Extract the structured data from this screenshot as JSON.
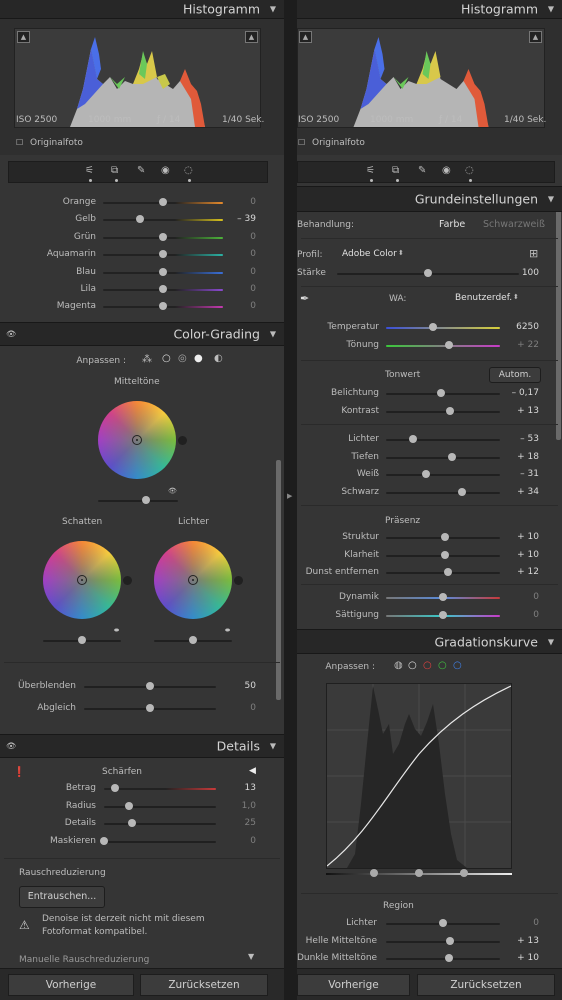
{
  "left": {
    "histogram": {
      "title": "Histogramm",
      "iso": "ISO 2500",
      "focal": "1000 mm",
      "aperture": "ƒ / 14",
      "shutter": "1/40 Sek.",
      "original_label": "Originalfoto"
    },
    "hsl": [
      {
        "name": "Orange",
        "value": "0",
        "dim": true,
        "color": "#e58a2c",
        "pos": 0.5
      },
      {
        "name": "Gelb",
        "value": "– 39",
        "dim": false,
        "color": "#d8c21e",
        "pos": 0.31
      },
      {
        "name": "Grün",
        "value": "0",
        "dim": true,
        "color": "#4db33a",
        "pos": 0.5
      },
      {
        "name": "Aquamarin",
        "value": "0",
        "dim": true,
        "color": "#2bb3a5",
        "pos": 0.5
      },
      {
        "name": "Blau",
        "value": "0",
        "dim": true,
        "color": "#3a6fd8",
        "pos": 0.5
      },
      {
        "name": "Lila",
        "value": "0",
        "dim": true,
        "color": "#8a4ad0",
        "pos": 0.5
      },
      {
        "name": "Magenta",
        "value": "0",
        "dim": true,
        "color": "#c43ab0",
        "pos": 0.5
      }
    ],
    "color_grading": {
      "title": "Color-Grading",
      "adjust_label": "Anpassen :",
      "midtones": "Mitteltöne",
      "shadows": "Schatten",
      "highlights": "Lichter",
      "blending": {
        "label": "Überblenden",
        "value": "50",
        "pos": 0.5
      },
      "balance": {
        "label": "Abgleich",
        "value": "0",
        "pos": 0.5
      }
    },
    "details": {
      "title": "Details",
      "sharpening": "Schärfen",
      "rows": [
        {
          "label": "Betrag",
          "value": "13",
          "dim": false,
          "pos": 0.1
        },
        {
          "label": "Radius",
          "value": "1,0",
          "dim": true,
          "pos": 0.22
        },
        {
          "label": "Details",
          "value": "25",
          "dim": true,
          "pos": 0.25
        },
        {
          "label": "Maskieren",
          "value": "0",
          "dim": true,
          "pos": 0.0
        }
      ],
      "noise_title": "Rauschreduzierung",
      "denoise_button": "Entrauschen...",
      "warning": "Denoise ist derzeit nicht mit diesem Fotoformat kompatibel.",
      "manual": "Manuelle Rauschreduzierung"
    },
    "buttons": {
      "previous": "Vorherige",
      "reset": "Zurücksetzen"
    }
  },
  "right": {
    "histogram": {
      "title": "Histogramm",
      "iso": "ISO 2500",
      "focal": "1000 mm",
      "aperture": "ƒ / 14",
      "shutter": "1/40 Sek.",
      "original_label": "Originalfoto"
    },
    "basic": {
      "title": "Grundeinstellungen",
      "treatment_label": "Behandlung:",
      "color": "Farbe",
      "bw": "Schwarzweiß",
      "profile_label": "Profil:",
      "profile_value": "Adobe Color",
      "amount_label": "Stärke",
      "amount_value": "100",
      "amount_pos": 0.5,
      "wb_label": "WA:",
      "wb_value": "Benutzerdef.",
      "temp": {
        "label": "Temperatur",
        "value": "6250",
        "pos": 0.41
      },
      "tint": {
        "label": "Tönung",
        "value": "+ 22",
        "pos": 0.55
      },
      "tone_label": "Tonwert",
      "auto": "Autom.",
      "tone": [
        {
          "label": "Belichtung",
          "value": "– 0,17",
          "pos": 0.48
        },
        {
          "label": "Kontrast",
          "value": "+ 13",
          "pos": 0.56
        },
        {
          "label": "Lichter",
          "value": "– 53",
          "pos": 0.24
        },
        {
          "label": "Tiefen",
          "value": "+ 18",
          "pos": 0.58
        },
        {
          "label": "Weiß",
          "value": "– 31",
          "pos": 0.35
        },
        {
          "label": "Schwarz",
          "value": "+ 34",
          "pos": 0.67
        }
      ],
      "presence_label": "Präsenz",
      "presence": [
        {
          "label": "Struktur",
          "value": "+ 10",
          "dim": false,
          "pos": 0.52
        },
        {
          "label": "Klarheit",
          "value": "+ 10",
          "dim": false,
          "pos": 0.52
        },
        {
          "label": "Dunst entfernen",
          "value": "+ 12",
          "dim": false,
          "pos": 0.54
        },
        {
          "label": "Dynamik",
          "value": "0",
          "dim": true,
          "pos": 0.5
        },
        {
          "label": "Sättigung",
          "value": "0",
          "dim": true,
          "pos": 0.5
        }
      ]
    },
    "curve": {
      "title": "Gradationskurve",
      "adjust_label": "Anpassen :",
      "region_label": "Region",
      "regions": [
        {
          "label": "Lichter",
          "value": "0",
          "dim": true,
          "pos": 0.5
        },
        {
          "label": "Helle Mitteltöne",
          "value": "+ 13",
          "dim": false,
          "pos": 0.56
        },
        {
          "label": "Dunkle Mitteltöne",
          "value": "+ 10",
          "dim": false,
          "pos": 0.55
        }
      ]
    },
    "buttons": {
      "previous": "Vorherige",
      "reset": "Zurücksetzen"
    }
  }
}
